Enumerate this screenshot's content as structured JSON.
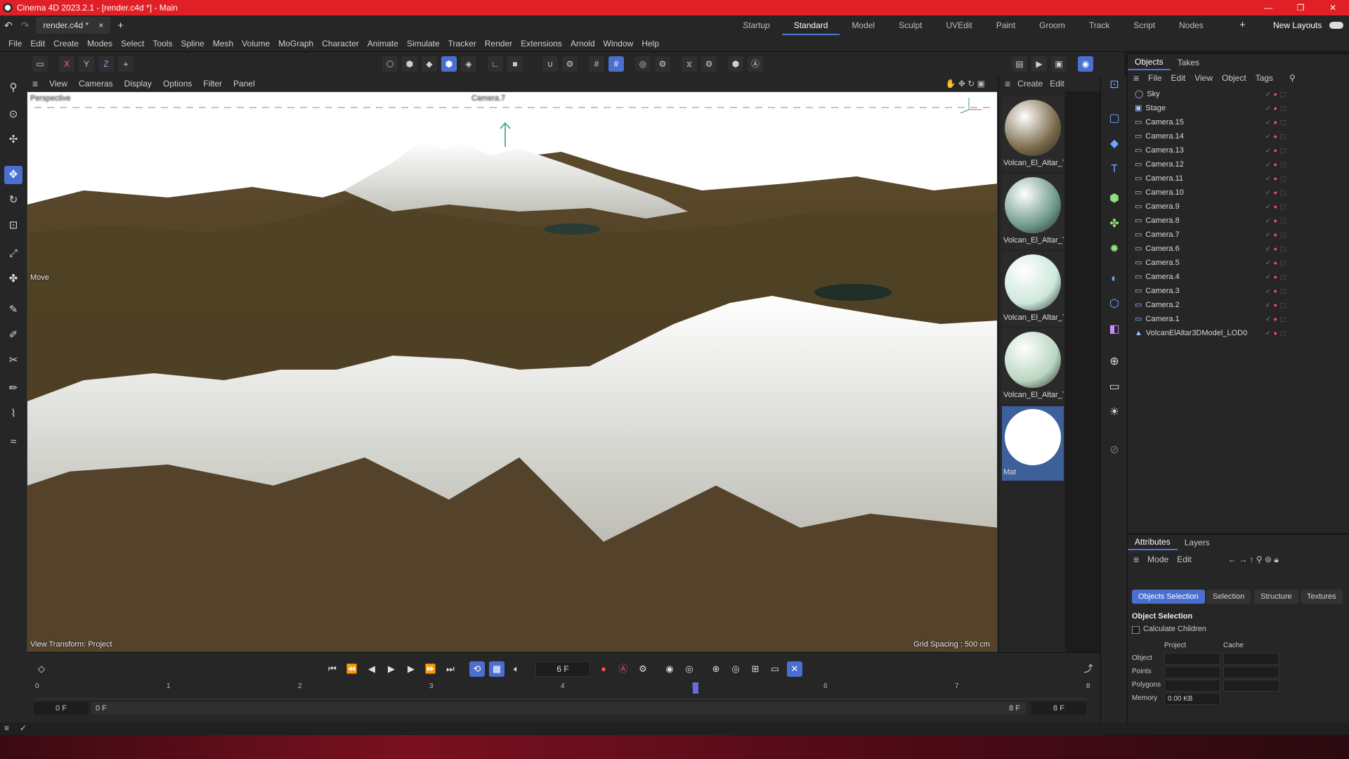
{
  "window": {
    "title": "Cinema 4D 2023.2.1 - [render.c4d *] - Main",
    "minimize": "—",
    "maximize": "❐",
    "close": "✕"
  },
  "doc_tab": {
    "name": "render.c4d *",
    "close": "×",
    "add": "+"
  },
  "layouts": [
    "Startup",
    "Standard",
    "Model",
    "Sculpt",
    "UVEdit",
    "Paint",
    "Groom",
    "Track",
    "Script",
    "Nodes"
  ],
  "layouts_extra": {
    "add": "+",
    "new_layouts": "New Layouts"
  },
  "menu": [
    "File",
    "Edit",
    "Create",
    "Modes",
    "Select",
    "Tools",
    "Spline",
    "Mesh",
    "Volume",
    "MoGraph",
    "Character",
    "Animate",
    "Simulate",
    "Tracker",
    "Render",
    "Extensions",
    "Arnold",
    "Window",
    "Help"
  ],
  "axis_buttons": {
    "x": "X",
    "y": "Y",
    "z": "Z"
  },
  "viewport_menu": [
    "View",
    "Cameras",
    "Display",
    "Options",
    "Filter",
    "Panel"
  ],
  "viewport": {
    "camera_label": "Perspective",
    "active_camera": "Camera.7",
    "tool_label": "Move",
    "view_transform": "View Transform: Project",
    "grid_spacing": "Grid Spacing : 500 cm"
  },
  "material_panel": {
    "menu": [
      "Create",
      "Edit"
    ]
  },
  "materials": [
    {
      "name": "Volcan_El_Altar_Te",
      "color": "#7a6a4a"
    },
    {
      "name": "Volcan_El_Altar_Te",
      "color": "#6f9a8a"
    },
    {
      "name": "Volcan_El_Altar_Te",
      "color": "#cde8dc"
    },
    {
      "name": "Volcan_El_Altar_Te",
      "color": "#b9d6c0"
    },
    {
      "name": "Mat",
      "color": "#ffffff"
    }
  ],
  "objects_panel": {
    "tabs": [
      "Objects",
      "Takes"
    ],
    "menu": [
      "File",
      "Edit",
      "View",
      "Object",
      "Tags"
    ],
    "items": [
      "Sky",
      "Stage",
      "Camera.15",
      "Camera.14",
      "Camera.13",
      "Camera.12",
      "Camera.11",
      "Camera.10",
      "Camera.9",
      "Camera.8",
      "Camera.7",
      "Camera.6",
      "Camera.5",
      "Camera.4",
      "Camera.3",
      "Camera.2",
      "Camera.1",
      "VolcanElAltar3DModel_LOD0"
    ]
  },
  "attributes_panel": {
    "tabs": [
      "Attributes",
      "Layers"
    ],
    "menu": [
      "Mode",
      "Edit"
    ],
    "subtabs": [
      "Objects Selection",
      "Selection",
      "Structure",
      "Textures"
    ],
    "section": "Object Selection",
    "checkbox": "Calculate Children",
    "col_project": "Project",
    "col_cache": "Cache",
    "rows": [
      "Object",
      "Points",
      "Polygons",
      "Memory"
    ],
    "memory_value": "0.00 KB"
  },
  "timeline": {
    "current_frame": "6 F",
    "ticks": [
      "0",
      "1",
      "2",
      "3",
      "4",
      "5",
      "6",
      "7",
      "8"
    ],
    "start": "0 F",
    "range_start": "0 F",
    "range_end": "8 F",
    "end": "8 F"
  }
}
